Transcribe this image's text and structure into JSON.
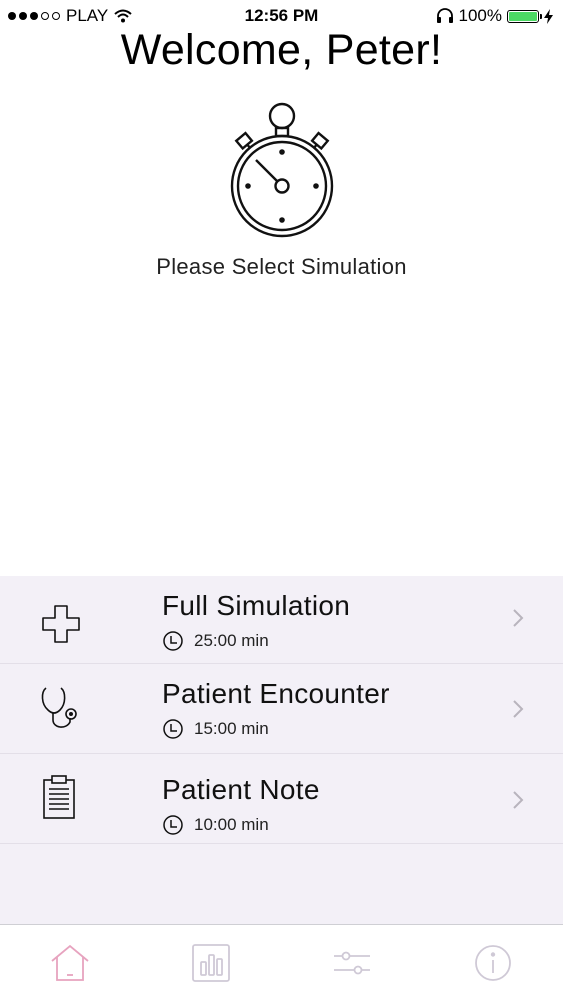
{
  "status_bar": {
    "carrier": "PLAY",
    "time": "12:56 PM",
    "battery": "100%"
  },
  "header": {
    "welcome": "Welcome, Peter!",
    "prompt": "Please Select Simulation",
    "icon": "stopwatch-icon"
  },
  "simulations": [
    {
      "title": "Full Simulation",
      "duration": "25:00 min",
      "icon": "medical-cross-icon"
    },
    {
      "title": "Patient Encounter",
      "duration": "15:00 min",
      "icon": "stethoscope-icon"
    },
    {
      "title": "Patient Note",
      "duration": "10:00 min",
      "icon": "clipboard-icon"
    }
  ],
  "tab_bar": {
    "tabs": [
      {
        "icon": "home-icon",
        "active": true
      },
      {
        "icon": "bar-chart-icon",
        "active": false
      },
      {
        "icon": "sliders-icon",
        "active": false
      },
      {
        "icon": "info-icon",
        "active": false
      }
    ]
  },
  "colors": {
    "list_background": "#f3f0f7",
    "active_tab": "#e7a3bf",
    "inactive_tab": "#cfc9d6",
    "battery": "#4cd964"
  }
}
